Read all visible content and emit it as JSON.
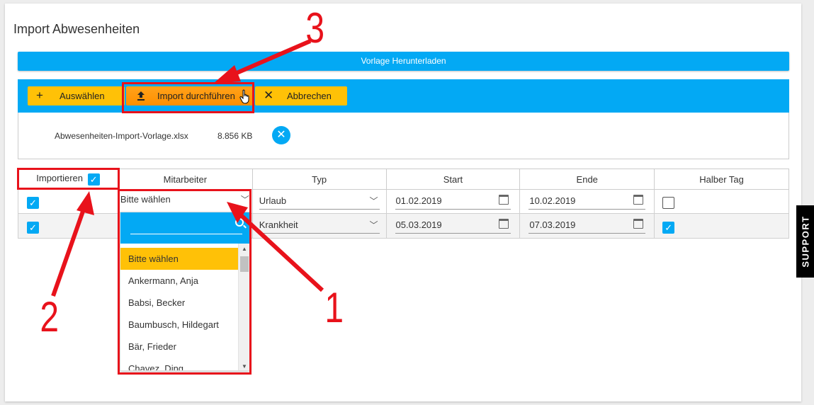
{
  "page": {
    "title": "Import Abwesenheiten"
  },
  "download": {
    "label": "Vorlage Herunterladen"
  },
  "toolbar": {
    "select_label": "Auswählen",
    "import_label": "Import durchführen",
    "cancel_label": "Abbrechen"
  },
  "file": {
    "name": "Abwesenheiten-Import-Vorlage.xlsx",
    "size": "8.856 KB"
  },
  "table": {
    "headers": [
      "Importieren",
      "Mitarbeiter",
      "Typ",
      "Start",
      "Ende",
      "Halber Tag"
    ],
    "rows": [
      {
        "importieren": true,
        "mitarbeiter": "Bitte wählen",
        "typ": "Urlaub",
        "start": "01.02.2019",
        "ende": "10.02.2019",
        "halber_tag": false
      },
      {
        "importieren": true,
        "mitarbeiter": "",
        "typ": "Krankheit",
        "start": "05.03.2019",
        "ende": "07.03.2019",
        "halber_tag": true
      }
    ]
  },
  "dropdown": {
    "search_value": "",
    "options": [
      "Bitte wählen",
      "Ankermann, Anja",
      "Babsi, Becker",
      "Baumbusch, Hildegart",
      "Bär, Frieder",
      "Chavez, Ding"
    ],
    "selected": "Bitte wählen"
  },
  "support": {
    "label": "SUPPORT"
  },
  "annotations": {
    "labels": [
      "1",
      "2",
      "3"
    ],
    "color": "#e8121b"
  },
  "colors": {
    "primary": "#03a9f4",
    "accent": "#ffc107",
    "import_button": "#ff8f00"
  }
}
